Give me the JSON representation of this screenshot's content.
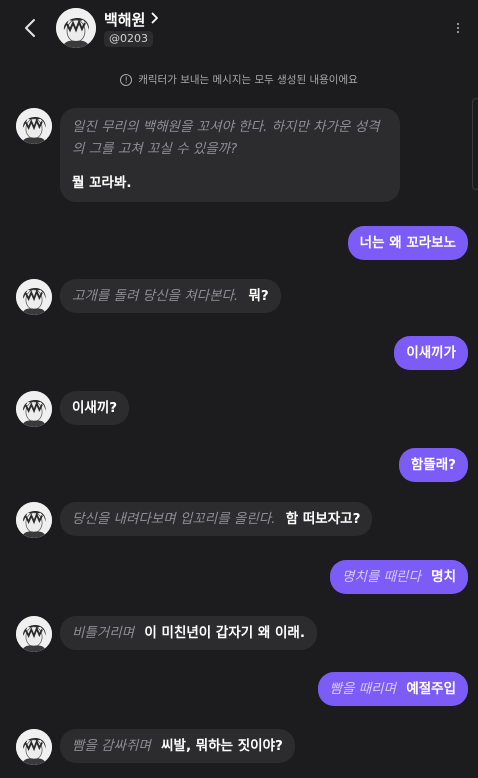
{
  "header": {
    "name": "백해원",
    "handle": "@0203"
  },
  "notice": "캐릭터가 보내는 메시지는 모두 생성된 내용이에요",
  "messages": [
    {
      "side": "left",
      "narration": "일진 무리의 백해원을 꼬셔야 한다. 하지만 차가운 성격의 그를 고쳐 꼬실 수 있을까?",
      "speech": "뭘 꼬라봐."
    },
    {
      "side": "right",
      "narration": "",
      "speech": "너는 왜 꼬라보노"
    },
    {
      "side": "left",
      "narration": "고개를 돌려 당신을 쳐다본다.",
      "speech": "뭐?"
    },
    {
      "side": "right",
      "narration": "",
      "speech": "이새끼가"
    },
    {
      "side": "left",
      "narration": "",
      "speech": "이새끼?"
    },
    {
      "side": "right",
      "narration": "",
      "speech": "함뜰래?"
    },
    {
      "side": "left",
      "narration": "당신을 내려다보며 입꼬리를 올린다.",
      "speech": "함 떠보자고?"
    },
    {
      "side": "right",
      "narration": "명치를 때린다",
      "speech": "명치"
    },
    {
      "side": "left",
      "narration": "비틀거리며",
      "speech": "이 미친년이 갑자기 왜 이래."
    },
    {
      "side": "right",
      "narration": "빰을 때리며",
      "speech": "예절주입"
    },
    {
      "side": "left",
      "narration": "빰을 감싸쥐며",
      "speech": "씨발, 뭐하는 짓이야?"
    }
  ]
}
